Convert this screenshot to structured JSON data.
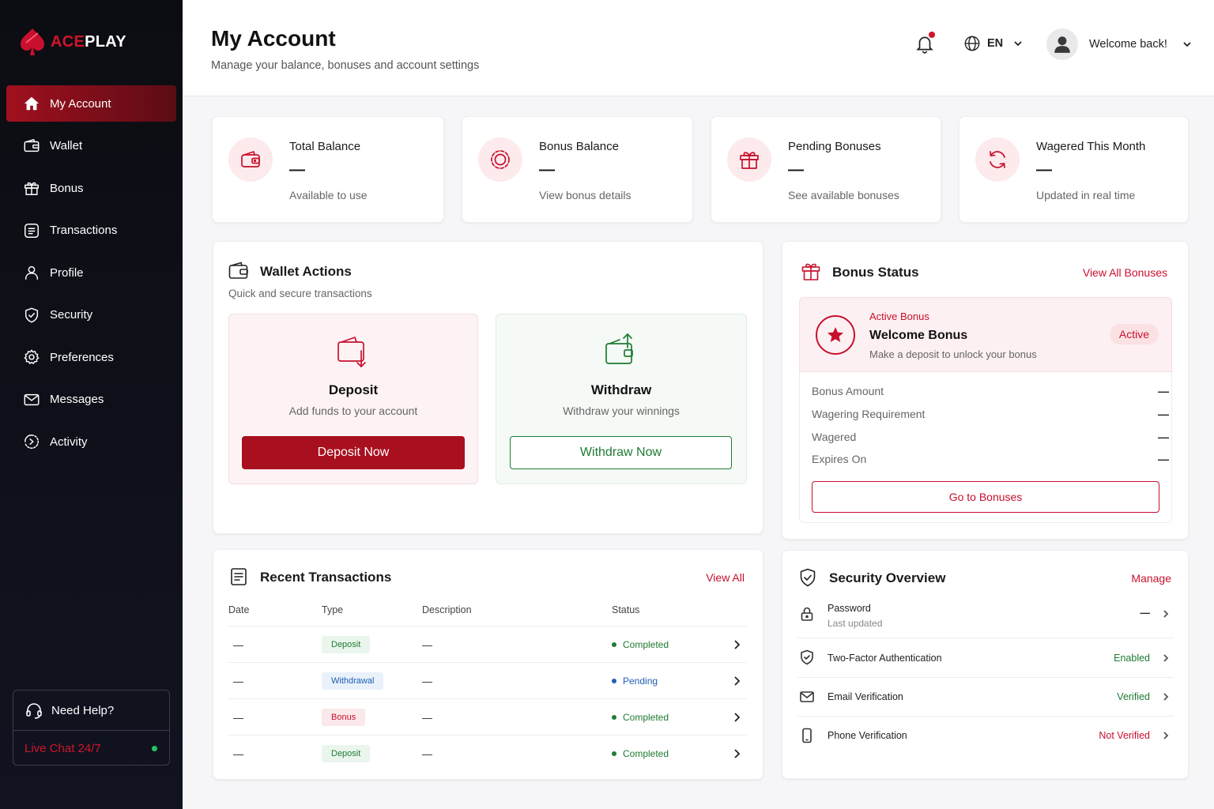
{
  "brand": {
    "name_part1": "ACE",
    "name_part2": "PLAY",
    "accent_color": "#c8102e"
  },
  "sidebar": {
    "items": [
      {
        "label": "My Account",
        "icon": "home-icon",
        "active": true
      },
      {
        "label": "Wallet",
        "icon": "wallet-icon"
      },
      {
        "label": "Bonus",
        "icon": "gift-icon"
      },
      {
        "label": "Transactions",
        "icon": "list-icon"
      },
      {
        "label": "Profile",
        "icon": "user-icon"
      },
      {
        "label": "Security",
        "icon": "shield-icon"
      },
      {
        "label": "Preferences",
        "icon": "gear-icon"
      },
      {
        "label": "Messages",
        "icon": "mail-icon"
      },
      {
        "label": "Activity",
        "icon": "activity-icon"
      }
    ],
    "help": {
      "title": "Need Help?",
      "chat": "Live Chat 24/7"
    }
  },
  "header": {
    "title": "My Account",
    "subtitle": "Manage your balance, bonuses and account settings",
    "language": "EN",
    "welcome": "Welcome back!"
  },
  "stats": [
    {
      "title": "Total Balance",
      "value": "—",
      "sub": "Available to use",
      "icon": "wallet-icon"
    },
    {
      "title": "Bonus Balance",
      "value": "—",
      "sub": "View bonus details",
      "icon": "chip-icon"
    },
    {
      "title": "Pending Bonuses",
      "value": "—",
      "sub": "See available bonuses",
      "icon": "gift-icon"
    },
    {
      "title": "Wagered This Month",
      "value": "—",
      "sub": "Updated in real time",
      "icon": "refresh-icon"
    }
  ],
  "wallet": {
    "title": "Wallet Actions",
    "subtitle": "Quick and secure transactions",
    "deposit": {
      "title": "Deposit",
      "sub": "Add funds to your account",
      "button": "Deposit Now"
    },
    "withdraw": {
      "title": "Withdraw",
      "sub": "Withdraw your winnings",
      "button": "Withdraw Now"
    }
  },
  "bonus_status": {
    "title": "Bonus Status",
    "view_all": "View All Bonuses",
    "active": {
      "label": "Active Bonus",
      "name": "Welcome Bonus",
      "desc": "Make a deposit to unlock your bonus",
      "badge": "Active"
    },
    "rows": [
      {
        "label": "Bonus Amount",
        "value": "—"
      },
      {
        "label": "Wagering Requirement",
        "value": "—"
      },
      {
        "label": "Wagered",
        "value": "—"
      },
      {
        "label": "Expires On",
        "value": "—"
      }
    ],
    "button": "Go to Bonuses"
  },
  "transactions": {
    "title": "Recent Transactions",
    "view_all": "View All",
    "columns": [
      "Date",
      "Type",
      "Description",
      "Status"
    ],
    "rows": [
      {
        "date": "—",
        "type": "Deposit",
        "type_kind": "deposit",
        "desc": "—",
        "status": "Completed",
        "status_kind": "completed"
      },
      {
        "date": "—",
        "type": "Withdrawal",
        "type_kind": "withdrawal",
        "desc": "—",
        "status": "Pending",
        "status_kind": "pending"
      },
      {
        "date": "—",
        "type": "Bonus",
        "type_kind": "bonus",
        "desc": "—",
        "status": "Completed",
        "status_kind": "completed"
      },
      {
        "date": "—",
        "type": "Deposit",
        "type_kind": "deposit",
        "desc": "—",
        "status": "Completed",
        "status_kind": "completed"
      }
    ]
  },
  "security": {
    "title": "Security Overview",
    "manage": "Manage",
    "rows": [
      {
        "label": "Password",
        "sub": "Last updated",
        "value": "—",
        "color": "#222222",
        "icon": "lock-icon"
      },
      {
        "label": "Two-Factor Authentication",
        "value": "Enabled",
        "color": "#1f7a32",
        "icon": "shield-icon"
      },
      {
        "label": "Email Verification",
        "value": "Verified",
        "color": "#1f7a32",
        "icon": "mail-icon"
      },
      {
        "label": "Phone Verification",
        "value": "Not Verified",
        "color": "#c8102e",
        "icon": "phone-icon"
      }
    ]
  }
}
